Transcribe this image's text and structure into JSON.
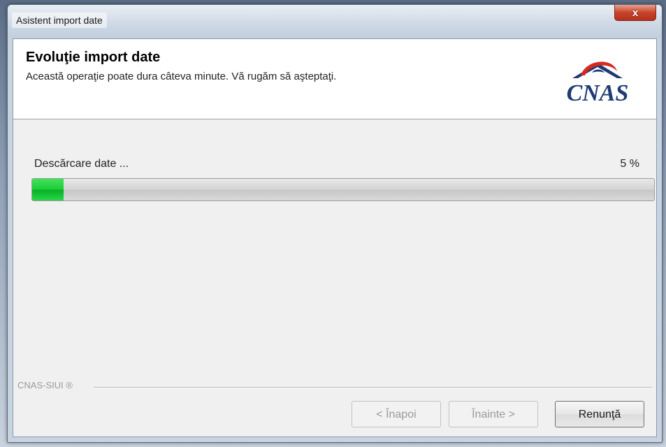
{
  "window": {
    "title": "Asistent import date",
    "close_glyph": "x"
  },
  "header": {
    "title": "Evoluţie import date",
    "subtitle": "Această operaţie poate dura câteva minute. Vă rugăm să aşteptaţi.",
    "logo_text": "CNAS",
    "logo_icon": "cnas-logo-icon"
  },
  "progress": {
    "label": "Descărcare date ...",
    "percent_text": "5 %",
    "value": 5,
    "fill_color": "#1fcc3a"
  },
  "footer": {
    "brand": "CNAS-SIUI ®",
    "buttons": {
      "back": "< Înapoi",
      "next": "Înainte >",
      "cancel": "Renunţă"
    }
  }
}
